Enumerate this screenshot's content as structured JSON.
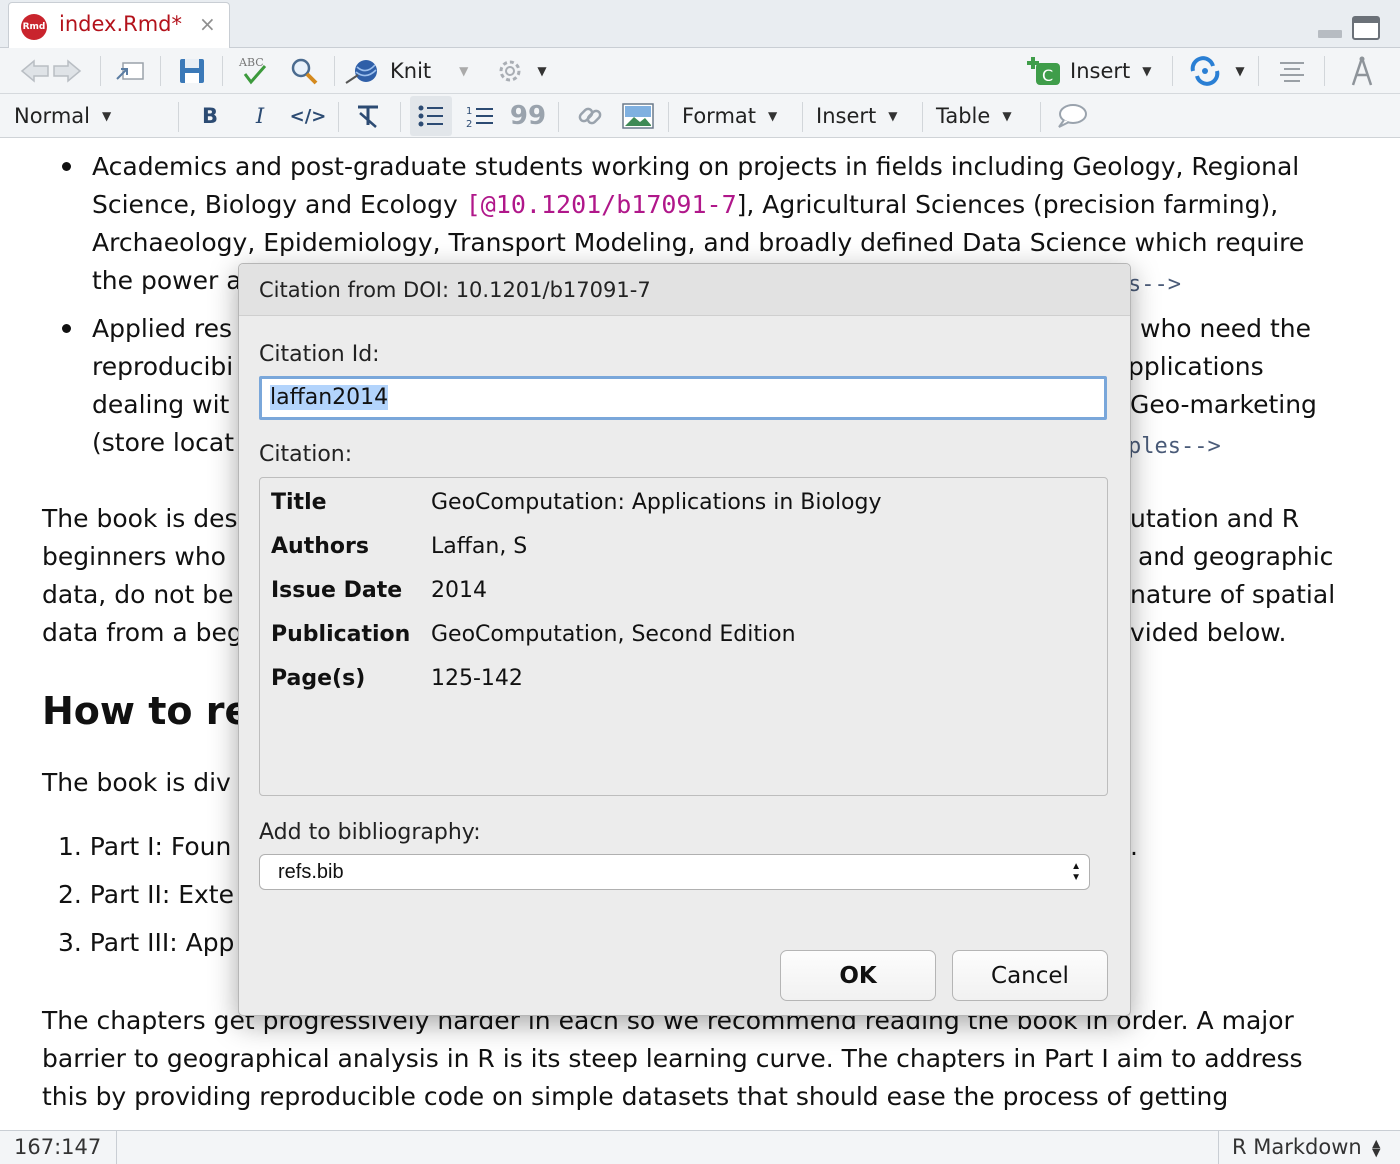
{
  "tab": {
    "icon_text": "Rmd",
    "filename": "index.Rmd*",
    "close": "×"
  },
  "toolbar": {
    "knit_label": "Knit",
    "insert_label": "Insert"
  },
  "format_bar": {
    "style": "Normal",
    "format_menu": "Format",
    "insert_menu": "Insert",
    "table_menu": "Table"
  },
  "editor": {
    "bullet1": {
      "l1": "Academics and post-graduate students working on projects in fields including Geology, Regional",
      "l2a": "Science, Biology and Ecology ",
      "l2cite": "[@10.1201/b17091-7",
      "l2b": "], Agricultural Sciences (precision farming),",
      "l3": "Archaeology, Epidemiology, Transport Modeling, and broadly defined Data Science which require",
      "l4a": "the power a",
      "l4comment": "s-->"
    },
    "bullet2": {
      "l1a": "Applied res",
      "l1b": "who need the",
      "l2a": "reproducibi",
      "l2b": "pplications",
      "l3a": "dealing wit",
      "l3b": "Geo-marketing",
      "l4a": "(store locat",
      "l4comment": "ples-->"
    },
    "para1": {
      "l1a": "The book is des",
      "l1b": "utation and R",
      "l2a": "beginners who",
      "l2b": "and geographic",
      "l3a": "data, do not be",
      "l3b": "nature of spatial",
      "l4a": "data from a beg",
      "l4b": "vided below."
    },
    "heading": "How to re",
    "para2": "The book is div",
    "list": [
      "1. Part I: Foun",
      "2. Part II: Exte",
      "3. Part III: App"
    ],
    "list_tail": ".",
    "para3": {
      "l1": "The chapters get progressively harder in each so we recommend reading the book in order. A major",
      "l2": "barrier to geographical analysis in R is its steep learning curve. The chapters in Part I aim to address",
      "l3": "this by providing reproducible code on simple datasets that should ease the process of getting"
    }
  },
  "dialog": {
    "title": "Citation from DOI: 10.1201/b17091-7",
    "citation_id_label": "Citation Id:",
    "citation_id_value": "laffan2014",
    "citation_label": "Citation:",
    "fields": [
      {
        "key": "Title",
        "value": "GeoComputation: Applications in Biology"
      },
      {
        "key": "Authors",
        "value": "Laffan, S"
      },
      {
        "key": "Issue Date",
        "value": "2014"
      },
      {
        "key": "Publication",
        "value": "GeoComputation, Second Edition"
      },
      {
        "key": "Page(s)",
        "value": "125-142"
      }
    ],
    "bibliography_label": "Add to bibliography:",
    "bibliography_value": "refs.bib",
    "ok_label": "OK",
    "cancel_label": "Cancel"
  },
  "statusbar": {
    "position": "167:147",
    "mode": "R Markdown"
  },
  "colors": {
    "tab_text": "#b3121b",
    "citation": "#b0178a",
    "comment": "#4a5b78",
    "focus_border": "#7aa7da"
  }
}
